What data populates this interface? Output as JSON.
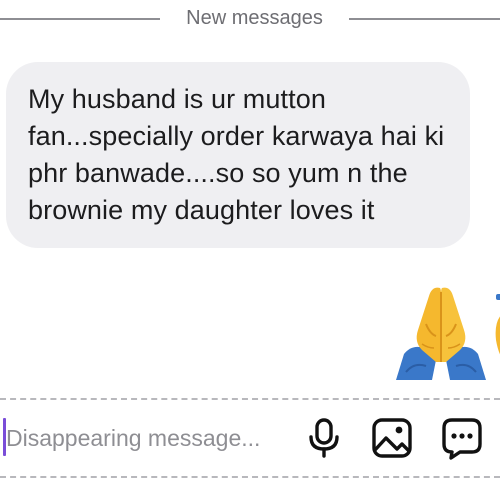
{
  "divider": {
    "label": "New messages"
  },
  "message": {
    "text": "My husband is ur mutton fan...specially order karwaya hai ki phr banwade....so so yum n the brownie my daughter loves it"
  },
  "reaction_emoji": {
    "name": "folded-hands",
    "char": "🙏"
  },
  "composer": {
    "placeholder": "Disappearing message...",
    "value": "",
    "icons": [
      "microphone-icon",
      "gallery-icon",
      "sticker-chat-icon"
    ]
  },
  "colors": {
    "bubble_bg": "#efeff2",
    "text": "#1c1c1e",
    "muted": "#8e8e93",
    "caret": "#7a4dd8",
    "emoji_skin": "#f5b82e",
    "emoji_sleeve": "#3a78c9"
  }
}
